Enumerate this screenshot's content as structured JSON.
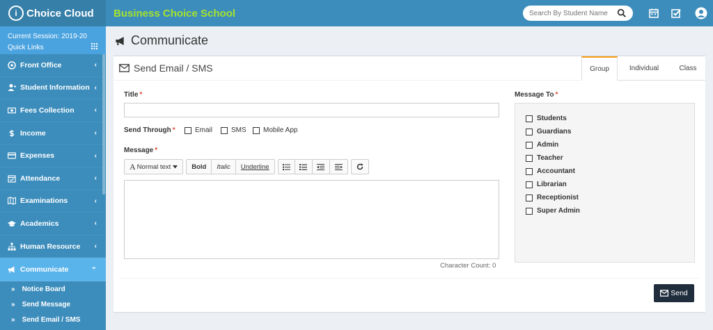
{
  "app": {
    "logo_mark": "i",
    "logo_text": "Choice Cloud",
    "school_name": "Business Choice School"
  },
  "header": {
    "search_placeholder": "Search By Student Name",
    "icons": [
      "calendar-icon",
      "task-check-icon",
      "user-avatar-icon"
    ]
  },
  "sidebar": {
    "session": "Current Session: 2019-20",
    "quick_links": "Quick Links",
    "items": [
      {
        "label": "Front Office",
        "icon": "front-office-icon"
      },
      {
        "label": "Student Information",
        "icon": "user-plus-icon"
      },
      {
        "label": "Fees Collection",
        "icon": "money-icon"
      },
      {
        "label": "Income",
        "icon": "dollar-icon"
      },
      {
        "label": "Expenses",
        "icon": "credit-card-icon"
      },
      {
        "label": "Attendance",
        "icon": "calendar-check-icon"
      },
      {
        "label": "Examinations",
        "icon": "map-icon"
      },
      {
        "label": "Academics",
        "icon": "graduation-cap-icon"
      },
      {
        "label": "Human Resource",
        "icon": "sitemap-icon"
      },
      {
        "label": "Communicate",
        "icon": "bullhorn-icon"
      }
    ],
    "chevron": "‹",
    "active_chevron": "⌄",
    "subitems": [
      "Notice Board",
      "Send Message",
      "Send Email / SMS"
    ],
    "sub_arrow": "»"
  },
  "page": {
    "title": "Communicate"
  },
  "form": {
    "box_title": "Send Email / SMS",
    "tabs": [
      "Group",
      "Individual",
      "Class"
    ],
    "active_tab": "Group",
    "title_label": "Title",
    "send_through_label": "Send Through",
    "send_options": [
      "Email",
      "SMS",
      "Mobile App"
    ],
    "message_label": "Message",
    "toolbar": {
      "normal_text": "Normal text",
      "normal_text_icon": "A",
      "bold": "Bold",
      "italic": "Italic",
      "underline": "Underline"
    },
    "char_count": "Character Count: 0",
    "message_to_label": "Message To",
    "roles": [
      "Students",
      "Guardians",
      "Admin",
      "Teacher",
      "Accountant",
      "Librarian",
      "Receptionist",
      "Super Admin"
    ],
    "required_mark": "*",
    "send_label": "Send"
  },
  "colors": {
    "primary": "#3c8dbc",
    "active_menu": "#5ab4ec",
    "accent_tab": "#f39c12",
    "send_button": "#1f2d3d",
    "school_name": "#a6e22e"
  }
}
